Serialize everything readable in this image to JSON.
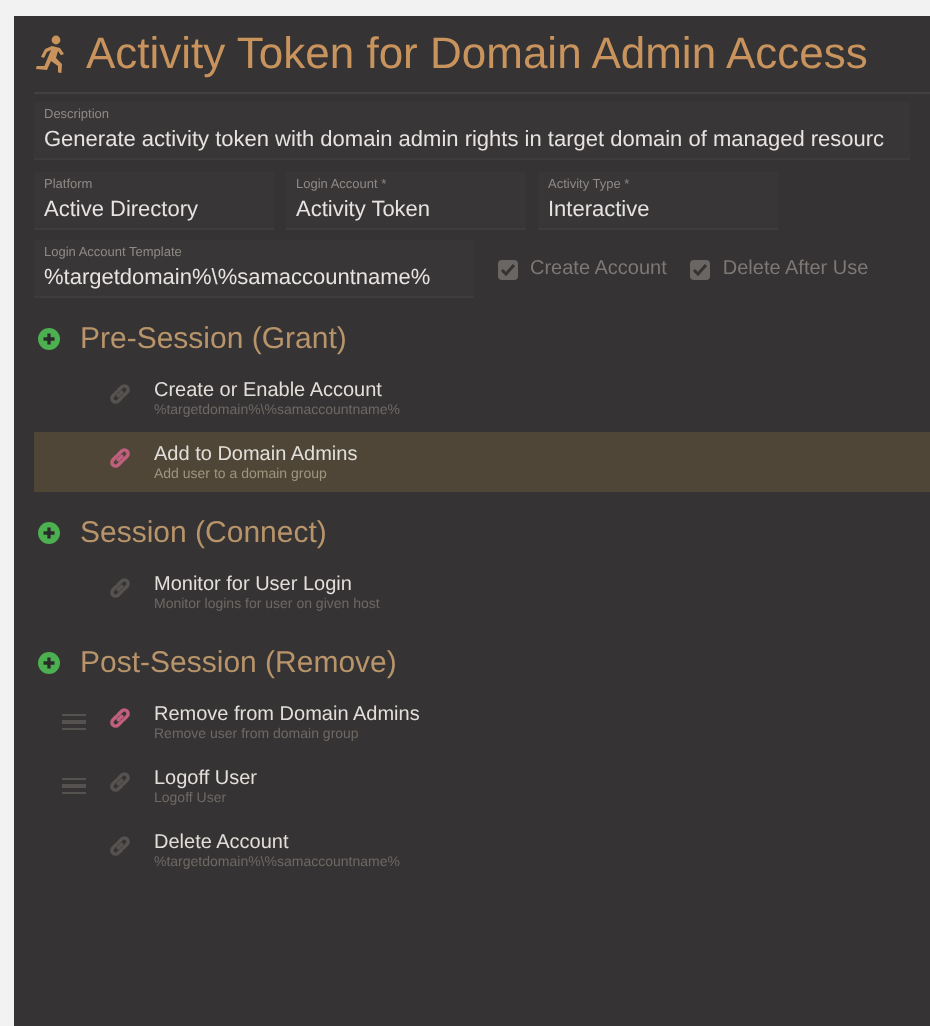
{
  "title": "Activity Token for Domain Admin Access",
  "description": {
    "label": "Description",
    "value": "Generate activity token with domain admin rights in target domain of managed resourc"
  },
  "fields": [
    {
      "label": "Platform",
      "value": "Active Directory"
    },
    {
      "label": "Login Account *",
      "value": "Activity Token"
    },
    {
      "label": "Activity Type *",
      "value": "Interactive"
    }
  ],
  "template": {
    "label": "Login Account Template",
    "value": "%targetdomain%\\%samaccountname%"
  },
  "options": [
    {
      "label": "Create Account",
      "checked": true,
      "disabled": true
    },
    {
      "label": "Delete After Use",
      "checked": true,
      "disabled": true
    }
  ],
  "sections": [
    {
      "title": "Pre-Session (Grant)",
      "items": [
        {
          "name": "Create or Enable Account",
          "detail": "%targetdomain%\\%samaccountname%",
          "selected": false,
          "active": false,
          "draggable": false
        },
        {
          "name": "Add to Domain Admins",
          "detail": "Add user to a domain group",
          "selected": true,
          "active": true,
          "draggable": false
        }
      ]
    },
    {
      "title": "Session (Connect)",
      "items": [
        {
          "name": "Monitor for User Login",
          "detail": "Monitor logins for user on given host",
          "selected": false,
          "active": false,
          "draggable": false
        }
      ]
    },
    {
      "title": "Post-Session (Remove)",
      "items": [
        {
          "name": "Remove from Domain Admins",
          "detail": "Remove user from domain group",
          "selected": false,
          "active": true,
          "draggable": true
        },
        {
          "name": "Logoff User",
          "detail": "Logoff User",
          "selected": false,
          "active": false,
          "draggable": true
        },
        {
          "name": "Delete Account",
          "detail": "%targetdomain%\\%samaccountname%",
          "selected": false,
          "active": false,
          "draggable": false
        }
      ]
    }
  ]
}
